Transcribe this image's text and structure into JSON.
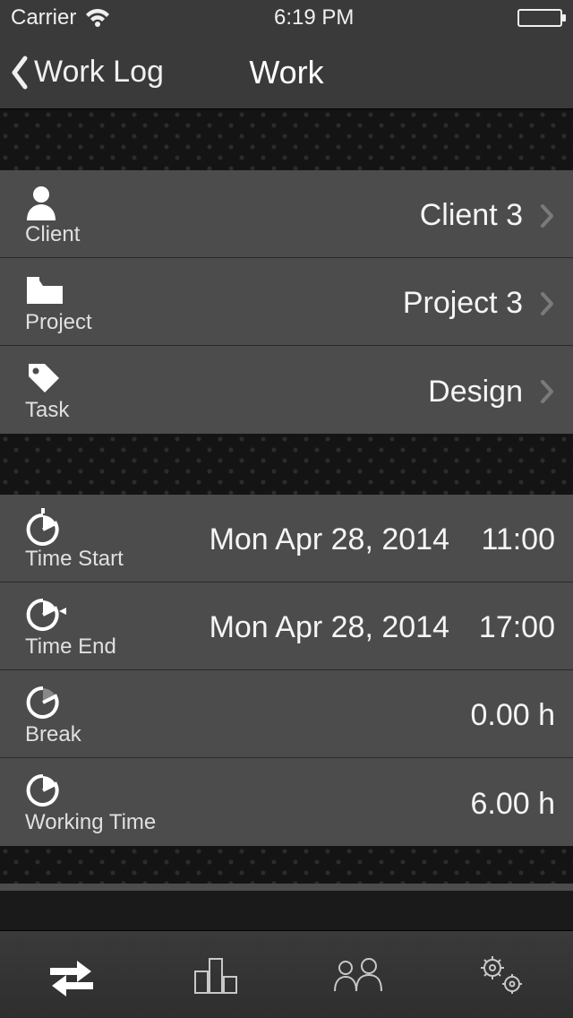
{
  "status": {
    "carrier": "Carrier",
    "time": "6:19 PM"
  },
  "nav": {
    "back": "Work Log",
    "title": "Work"
  },
  "section1": {
    "client": {
      "label": "Client",
      "value": "Client 3"
    },
    "project": {
      "label": "Project",
      "value": "Project 3"
    },
    "task": {
      "label": "Task",
      "value": "Design"
    }
  },
  "section2": {
    "start": {
      "label": "Time Start",
      "date": "Mon Apr 28, 2014",
      "time": "11:00"
    },
    "end": {
      "label": "Time End",
      "date": "Mon Apr 28, 2014",
      "time": "17:00"
    },
    "break": {
      "label": "Break",
      "value": "0.00 h"
    },
    "working": {
      "label": "Working Time",
      "value": "6.00 h"
    }
  }
}
